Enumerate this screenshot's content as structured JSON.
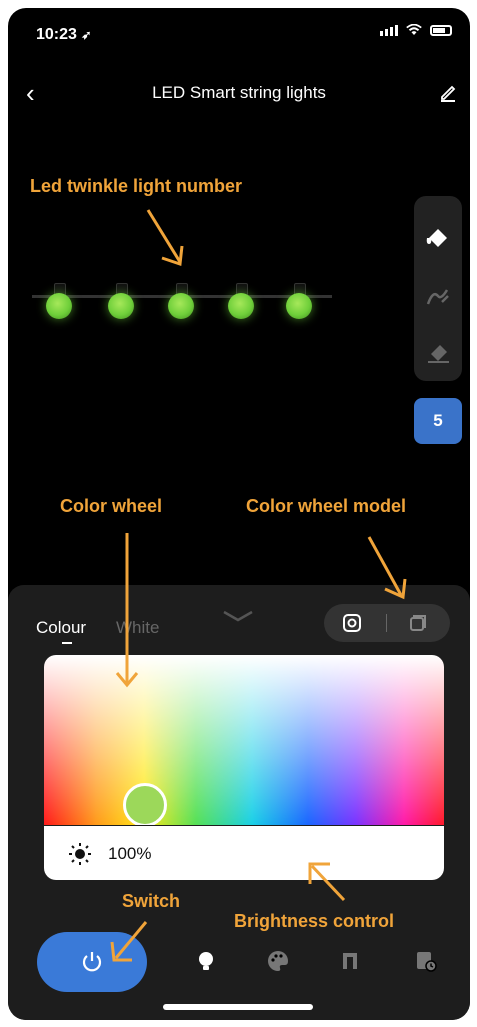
{
  "status": {
    "time": "10:23",
    "location_icon": "location-arrow-icon"
  },
  "header": {
    "title": "LED Smart string lights",
    "back_icon": "chevron-left-icon",
    "edit_icon": "pencil-icon"
  },
  "annotations": {
    "led_number": "Led twinkle light number",
    "color_wheel": "Color wheel",
    "color_wheel_model": "Color wheel model",
    "switch": "Switch",
    "brightness_control": "Brightness control",
    "color": "#f0a43a"
  },
  "lights": {
    "count_label": "5",
    "bulb_color": "#6fcf3a"
  },
  "tools": [
    "paint-bucket-icon",
    "brush-icon",
    "eraser-icon"
  ],
  "panel": {
    "tabs": [
      "Colour",
      "White"
    ],
    "collapse_icon": "chevron-down-icon",
    "mode_icons": [
      "color-wheel-mode-icon",
      "color-block-mode-icon"
    ]
  },
  "brightness": {
    "value_label": "100%",
    "icon": "sun-icon"
  },
  "bottom_nav": [
    "power-icon",
    "bulb-icon",
    "palette-icon",
    "music-icon",
    "schedule-icon"
  ],
  "colors": {
    "accent": "#3a7ad8",
    "background": "#000000",
    "panel": "#1d1d1d"
  }
}
